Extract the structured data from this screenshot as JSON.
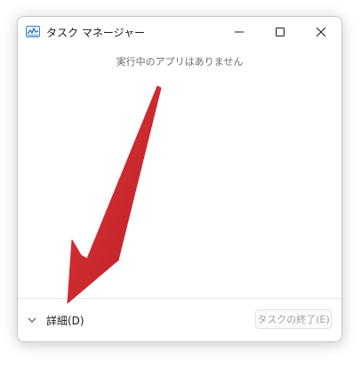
{
  "window": {
    "title": "タスク マネージャー",
    "icon": "task-manager-icon"
  },
  "titlebar_buttons": {
    "minimize_icon": "minimize-icon",
    "maximize_icon": "maximize-icon",
    "close_icon": "close-icon"
  },
  "main": {
    "status": "実行中のアプリはありません"
  },
  "footer": {
    "details_label": "詳細(D)",
    "details_icon": "chevron-down-icon",
    "end_task_label": "タスクの終了(E)"
  },
  "annotation": {
    "arrow_color": "#d0282e"
  }
}
